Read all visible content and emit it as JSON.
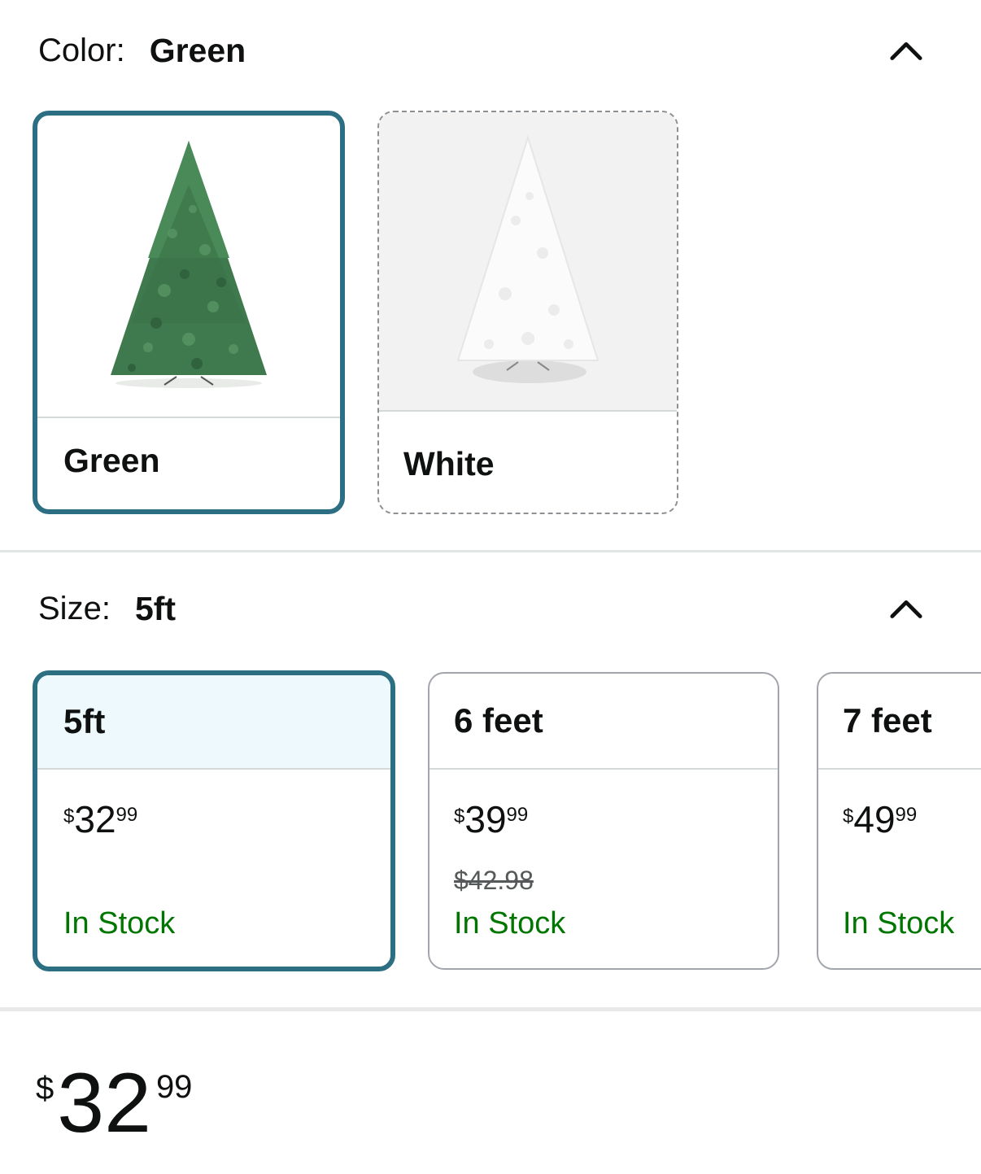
{
  "color_section": {
    "label": "Color:",
    "selected_value": "Green",
    "options": [
      {
        "label": "Green",
        "state": "selected",
        "image": "green-christmas-tree"
      },
      {
        "label": "White",
        "state": "unavailable",
        "image": "white-christmas-tree"
      }
    ]
  },
  "size_section": {
    "label": "Size:",
    "selected_value": "5ft",
    "options": [
      {
        "label": "5ft",
        "currency": "$",
        "whole": "32",
        "fraction": "99",
        "was_price": "",
        "availability": "In Stock",
        "state": "selected"
      },
      {
        "label": "6 feet",
        "currency": "$",
        "whole": "39",
        "fraction": "99",
        "was_price": "$42.98",
        "availability": "In Stock",
        "state": "available"
      },
      {
        "label": "7 feet",
        "currency": "$",
        "whole": "49",
        "fraction": "99",
        "was_price": "",
        "availability": "In Stock",
        "state": "available"
      }
    ]
  },
  "price": {
    "currency": "$",
    "whole": "32",
    "fraction": "99"
  },
  "colors": {
    "selected_border": "#2c6e82",
    "selected_header_bg": "#edf9fc",
    "in_stock": "#007600",
    "text": "#0f1111"
  },
  "icons": {
    "collapse": "chevron-up-icon"
  }
}
